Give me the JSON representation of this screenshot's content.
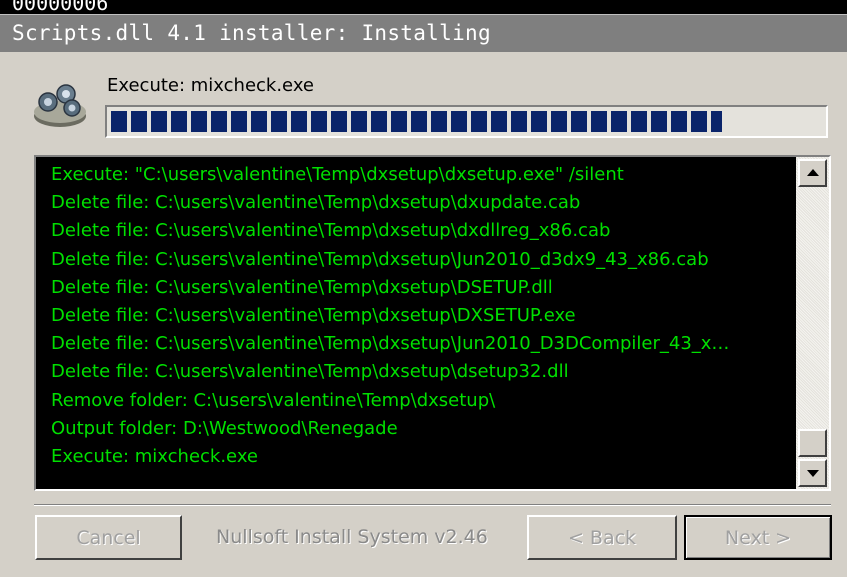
{
  "window": {
    "bg_title_fragment": "00000006",
    "title": "Scripts.dll 4.1 installer: Installing"
  },
  "status": {
    "text": "Execute: mixcheck.exe",
    "progress_percent": 86
  },
  "log": {
    "lines": [
      "Execute: \"C:\\users\\valentine\\Temp\\dxsetup\\dxsetup.exe\" /silent",
      "Delete file: C:\\users\\valentine\\Temp\\dxsetup\\dxupdate.cab",
      "Delete file: C:\\users\\valentine\\Temp\\dxsetup\\dxdllreg_x86.cab",
      "Delete file: C:\\users\\valentine\\Temp\\dxsetup\\Jun2010_d3dx9_43_x86.cab",
      "Delete file: C:\\users\\valentine\\Temp\\dxsetup\\DSETUP.dll",
      "Delete file: C:\\users\\valentine\\Temp\\dxsetup\\DXSETUP.exe",
      "Delete file: C:\\users\\valentine\\Temp\\dxsetup\\Jun2010_D3DCompiler_43_x…",
      "Delete file: C:\\users\\valentine\\Temp\\dxsetup\\dsetup32.dll",
      "Remove folder: C:\\users\\valentine\\Temp\\dxsetup\\",
      "Output folder: D:\\Westwood\\Renegade",
      "Execute: mixcheck.exe"
    ],
    "text_color": "#00e000"
  },
  "footer": {
    "cancel_label": "Cancel",
    "brand_text": "Nullsoft Install System v2.46",
    "back_label": "< Back",
    "next_label": "Next >"
  },
  "icons": {
    "installer": "install-gears-icon",
    "scroll_up": "scroll-up-arrow-icon",
    "scroll_down": "scroll-down-arrow-icon"
  },
  "colors": {
    "progress": "#0a246a",
    "dialog_bg": "#d4d0c8",
    "titlebar": "#7f7f7f"
  }
}
